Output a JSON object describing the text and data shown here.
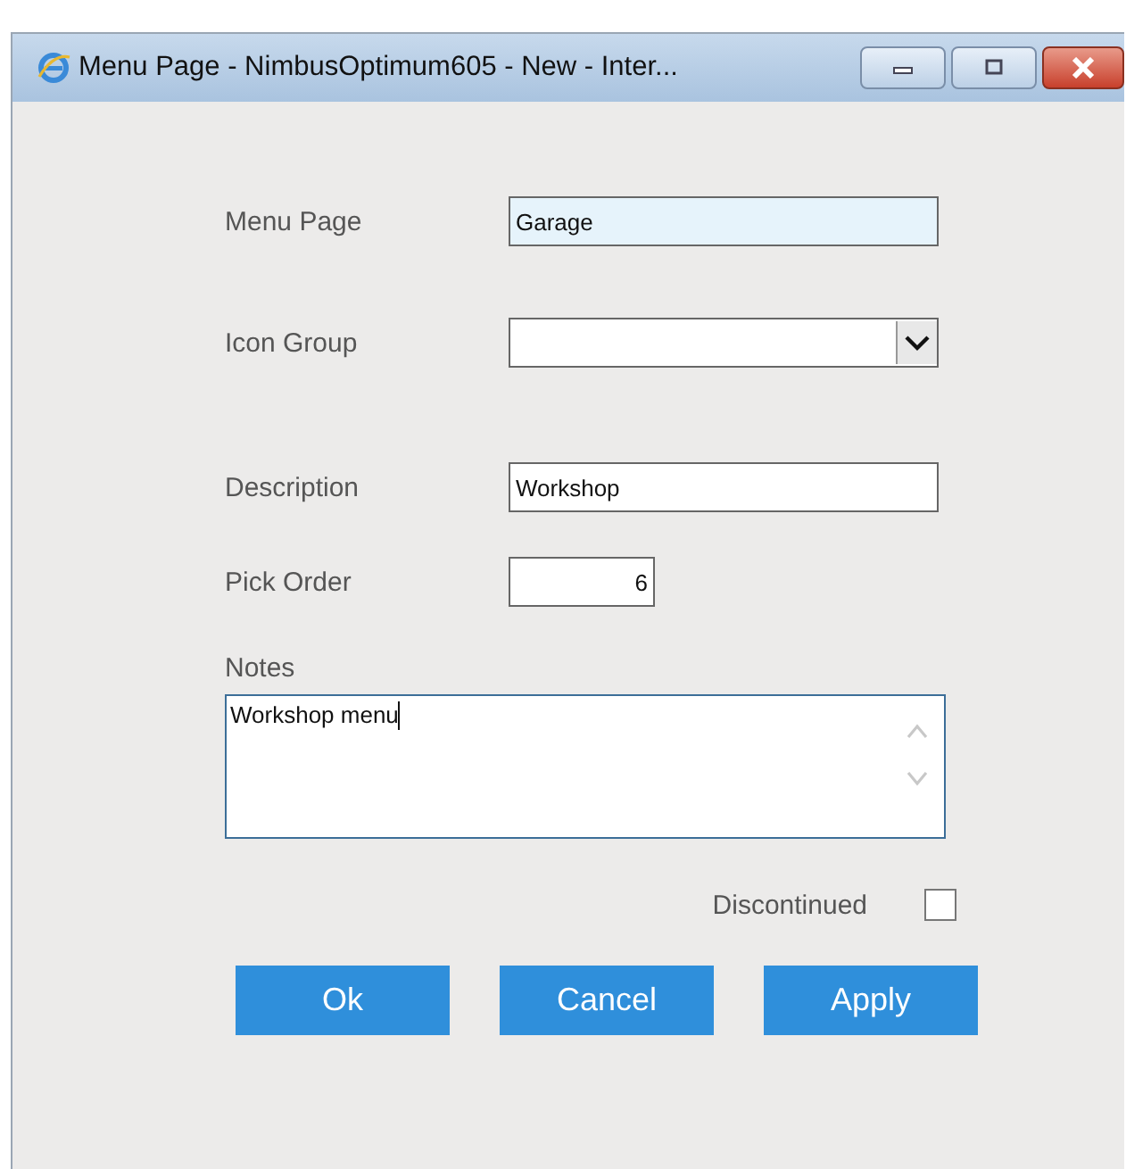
{
  "window": {
    "title": "Menu Page - NimbusOptimum605 - New - Inter..."
  },
  "fields": [
    {
      "kind": "text",
      "label": "Menu Page",
      "value": "Garage",
      "highlighted": true
    },
    {
      "kind": "select",
      "label": "Icon Group",
      "highlighted": false
    },
    {
      "kind": "text",
      "label": "Description",
      "value": "Workshop",
      "highlighted": false
    },
    {
      "kind": "number",
      "label": "Pick Order",
      "value": "6",
      "highlighted": false
    }
  ],
  "notes": {
    "label": "Notes",
    "value": "Workshop menu"
  },
  "discontinued": {
    "label": "Discontinued",
    "checked": false
  },
  "buttons": [
    "Ok",
    "Cancel",
    "Apply"
  ]
}
